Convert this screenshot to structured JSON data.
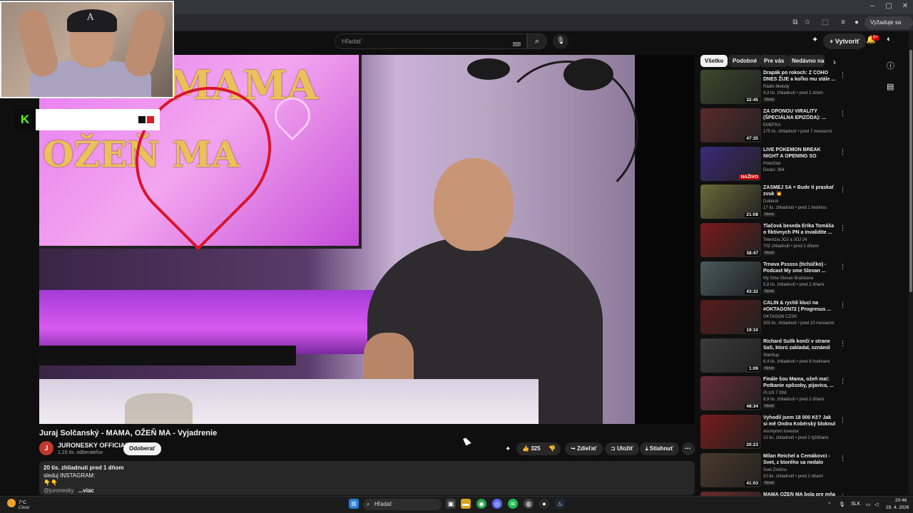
{
  "browser": {
    "window_controls": [
      "–",
      "▢",
      "✕"
    ],
    "signed_pill": "Vyžaduje sa akcia"
  },
  "header": {
    "search_placeholder": "Hľadať",
    "create_label": "Vytvoriť",
    "notification_count": "9+"
  },
  "video": {
    "title": "Juraj Solčanský - MAMA, OŽEŇ MA - Vyjadrenie",
    "tv_title_line1": "MAMA",
    "tv_title_line2": "OŽEŇ MA",
    "channel": "JURONESKY OFFICIAL",
    "channel_initial": "J",
    "subscribers": "1,15 tis. odberateľov",
    "subscribe_label": "Odoberať",
    "like_count": "325",
    "share_label": "Zdieľať",
    "save_label": "Uložiť",
    "download_label": "Stiahnuť",
    "description": {
      "meta": "20 tis. zhliadnutí  pred 1 dňom",
      "line1": "sleduj INSTAGRAM:",
      "line2": "👇👇",
      "handle": "@juronesky",
      "more": "...viac"
    }
  },
  "chips": [
    "Všetko",
    "Podobné",
    "Pre vás",
    "Nedávno nahraté"
  ],
  "recommendations": [
    {
      "title": "Drapák po rokoch: Z ČOHO DNES ŽIJE a koľko mu stále ...",
      "channel": "Rádio Melody",
      "meta": "4,3 tis. zhliadnutí • pred 1 dňom",
      "duration": "32:45",
      "badge": "Nové",
      "thumb": "#3b4a2c"
    },
    {
      "title": "ZA OPONOU VIRALITY (ŠPECIÁLNA EPIZÓDA): ...",
      "channel": "EMEFKA",
      "meta": "175 tis. zhliadnutí • pred 7 mesiacmi",
      "duration": "47:35",
      "badge": "",
      "thumb": "#5a2a2a"
    },
    {
      "title": "LIVE POKEMON BREAK NIGHT A OPENING SO SEPAROM VOL...",
      "channel": "PokeStar",
      "meta": "Diváci: 364",
      "duration": "NAŽIVO",
      "badge": "",
      "thumb": "#3a2a7a"
    },
    {
      "title": "ZASMEJ SA = Bude ti praskať zvuk 💥",
      "channel": "Duklock",
      "meta": "17 tis. zhliadnutí • pred 1 hodinou",
      "duration": "21:08",
      "badge": "Nové",
      "thumb": "#6a6a3a"
    },
    {
      "title": "Tlačová beseda Erika Tomáša o fiktívnych PN a invalidite ...",
      "channel": "Televízia JOJ a JOJ 24",
      "meta": "702 zhliadnutí • pred 2 dňami",
      "duration": "38:47",
      "badge": "Nové",
      "thumb": "#7a1a1a"
    },
    {
      "title": "Trnava Psssss (tichúčko) - Podcast My sme Slovan ...",
      "channel": "My Sme Slovan Bratislava",
      "meta": "5,8 tis. zhliadnutí • pred 2 dňami",
      "duration": "43:32",
      "badge": "Nové",
      "thumb": "#4a5a5a"
    },
    {
      "title": "CALIN & rychlí kluci na #OKTAGON72 | Progresus ...",
      "channel": "OKTAGON CZSK",
      "meta": "303 tis. zhliadnutí • pred 10 mesiacmi",
      "duration": "19:10",
      "badge": "",
      "thumb": "#5a1a1a"
    },
    {
      "title": "Richard Sulík končí v strane SaS, ktorú zakladal, oznámil aj...",
      "channel": "Startitup",
      "meta": "6,4 tis. zhliadnutí • pred 9 hodinami",
      "duration": "1:09",
      "badge": "Nové",
      "thumb": "#3a3a3a"
    },
    {
      "title": "Finále šou Mama, ožeň ma!: Potkanie spôsoby, pijavica, ...",
      "channel": "PLUS 7 DNÍ",
      "meta": "8,9 tis. zhliadnutí • pred 2 dňami",
      "duration": "48:34",
      "badge": "Nové",
      "thumb": "#6a2a3a"
    },
    {
      "title": "Vyhodil jsem 18 000 Kč? Jak si mě Ondra Kobérský bloknul + ...",
      "channel": "Anonymní Investor",
      "meta": "10 tis. zhliadnutí • pred 2 týždňami",
      "duration": "20:23",
      "badge": "",
      "thumb": "#7a1a1a"
    },
    {
      "title": "Milan Reichel a Čemákovci - Svet, z ktorého sa nedalo odísť",
      "channel": "Svet Zločinu",
      "meta": "10 tis. zhliadnutí • pred 2 dňami",
      "duration": "41:03",
      "badge": "Nové",
      "thumb": "#4a3a2a"
    },
    {
      "title": "MAMA OŽEŇ MA bola pre mňa zvrat. Ivo Iskrá... TOMÁŠ...",
      "channel": "",
      "meta": "",
      "duration": "",
      "badge": "",
      "thumb": "#6a2a2a"
    }
  ],
  "taskbar": {
    "weather_temp": "7°C",
    "weather_desc": "Clear",
    "search_label": "Hľadať",
    "lang": "SLK",
    "time": "20:46",
    "date": "29. 4. 2026"
  }
}
